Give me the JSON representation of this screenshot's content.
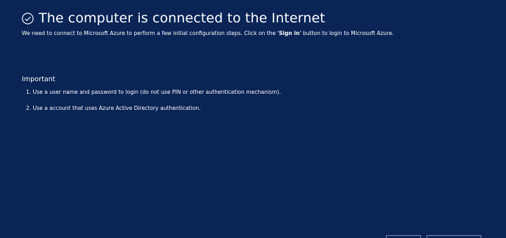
{
  "header": {
    "icon": "check-circle-icon",
    "title": "The computer is connected to the Internet",
    "subtitle_before": "We need to connect to Microsoft Azure to perform a few initial configuration steps. Click on the '",
    "subtitle_bold": "Sign in",
    "subtitle_after": "' button to login to Microsoft Azure."
  },
  "important": {
    "heading": "Important",
    "items": [
      "1. Use a user name and password to login (do not use PIN or other authentication mechanism).",
      "2. Use a account that uses Azure Active Directory authentication."
    ]
  },
  "colors": {
    "background": "#0a2456",
    "text": "#ffffff"
  }
}
